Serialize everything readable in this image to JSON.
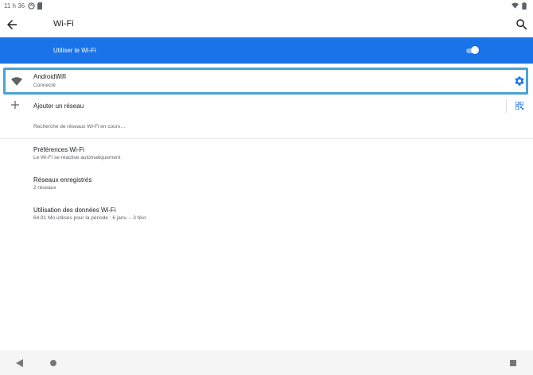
{
  "status_bar": {
    "time": "11 h 36"
  },
  "app_bar": {
    "title": "Wi-Fi"
  },
  "master_switch": {
    "label": "Utiliser le Wi-Fi",
    "state": "on"
  },
  "connected_network": {
    "name": "AndroidWifi",
    "status": "Connecté"
  },
  "add_network": {
    "label": "Ajouter un réseau"
  },
  "scan_status": {
    "text": "Recherche de réseaux Wi-Fi en cours…"
  },
  "settings_items": [
    {
      "title": "Préférences Wi-Fi",
      "subtitle": "Le Wi-Fi se réactive automatiquement"
    },
    {
      "title": "Réseaux enregistrés",
      "subtitle": "2 réseaux"
    },
    {
      "title": "Utilisation des données Wi-Fi",
      "subtitle": "64,91 Mo utilisés pour la période : 6 janv. – 3 févr."
    }
  ],
  "colors": {
    "accent": "#1a73e8",
    "highlight_border": "#4aa3d4",
    "icon_blue": "#1a73e8",
    "icon_gray": "#5f6368"
  },
  "icons": [
    "wifi-status-icon",
    "battery-icon",
    "back-arrow-icon",
    "search-icon",
    "wifi-icon",
    "gear-icon",
    "plus-icon",
    "qr-code-icon",
    "nav-back-icon",
    "nav-home-icon",
    "nav-recents-icon"
  ]
}
